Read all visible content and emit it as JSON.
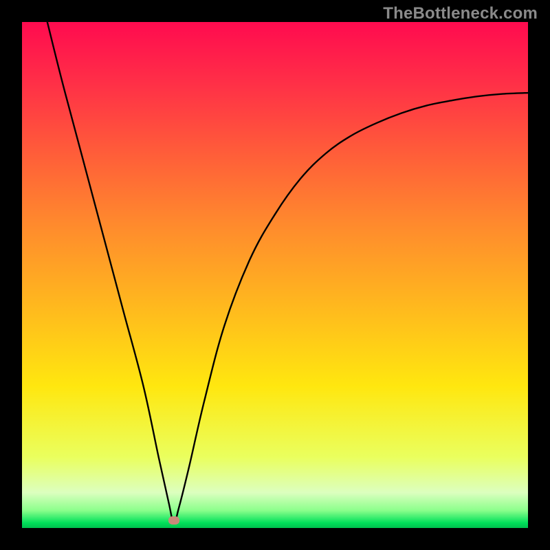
{
  "watermark": "TheBottleneck.com",
  "colors": {
    "frame": "#000000",
    "watermark": "#8a8a8a",
    "curve": "#000000",
    "marker": "#c98a7a",
    "gradient_stops": [
      "#ff0b4f",
      "#ff2f47",
      "#ff5a3a",
      "#ff8a2d",
      "#ffb51f",
      "#ffe70f",
      "#eaff5e",
      "#dcffbf",
      "#8cff8c",
      "#00e05a",
      "#00c04e"
    ]
  },
  "chart_data": {
    "type": "line",
    "title": "",
    "xlabel": "",
    "ylabel": "",
    "xlim": [
      0,
      100
    ],
    "ylim": [
      0,
      100
    ],
    "grid": false,
    "legend": false,
    "marker": {
      "x": 30,
      "y": 1.5
    },
    "series": [
      {
        "name": "curve",
        "x": [
          5,
          8,
          12,
          16,
          20,
          24,
          27,
          29,
          30,
          31,
          33,
          36,
          40,
          45,
          50,
          55,
          60,
          65,
          70,
          75,
          80,
          85,
          90,
          95,
          100
        ],
        "values": [
          100,
          88,
          73,
          58,
          43,
          28,
          14,
          5,
          1,
          4,
          12,
          25,
          40,
          53,
          62,
          69,
          74,
          77.5,
          80,
          82,
          83.5,
          84.5,
          85.3,
          85.8,
          86
        ]
      }
    ]
  }
}
